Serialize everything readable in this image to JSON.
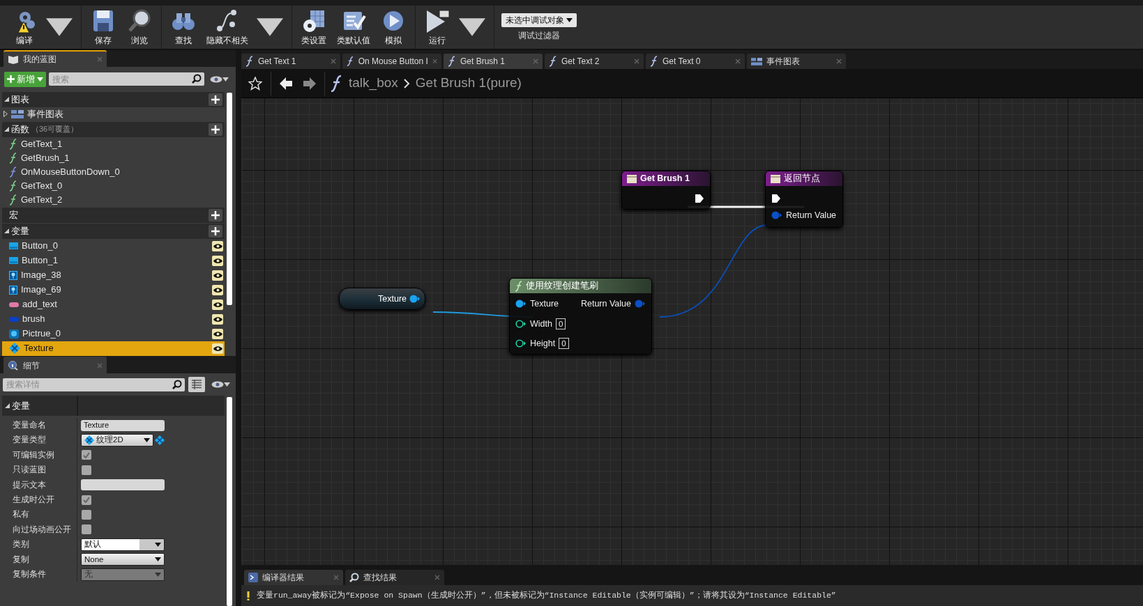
{
  "toolbar": {
    "groups": [
      [
        {
          "label": "编译",
          "kind": "compile",
          "dropdown": true
        }
      ],
      [
        {
          "label": "保存",
          "kind": "save",
          "dropdown": false
        },
        {
          "label": "浏览",
          "kind": "browse",
          "dropdown": false
        }
      ],
      [
        {
          "label": "查找",
          "kind": "find",
          "dropdown": false
        },
        {
          "label": "隐藏不相关",
          "kind": "hide",
          "dropdown": true
        }
      ],
      [
        {
          "label": "类设置",
          "kind": "settings",
          "dropdown": false
        },
        {
          "label": "类默认值",
          "kind": "defaults",
          "dropdown": false
        },
        {
          "label": "模拟",
          "kind": "simulate",
          "dropdown": false
        }
      ],
      [
        {
          "label": "运行",
          "kind": "run",
          "dropdown": true
        }
      ]
    ],
    "debug_filter": {
      "value": "未选中调试对象",
      "label": "调试过滤器"
    }
  },
  "my_blueprint": {
    "tab": "我的蓝图",
    "new_button": "新增",
    "search": {
      "placeholder": "搜索"
    },
    "sections": [
      {
        "title": "图表",
        "expanded": true,
        "items": [
          {
            "label": "事件图表",
            "kind": "graph",
            "expanded": false
          }
        ]
      },
      {
        "title": "函数",
        "note": "（36可覆盖）",
        "expanded": true,
        "items": [
          {
            "label": "GetText_1",
            "kind": "function"
          },
          {
            "label": "GetBrush_1",
            "kind": "function"
          },
          {
            "label": "OnMouseButtonDown_0",
            "kind": "override"
          },
          {
            "label": "GetText_0",
            "kind": "function"
          },
          {
            "label": "GetText_2",
            "kind": "function"
          }
        ]
      },
      {
        "title": "宏"
      },
      {
        "title": "变量",
        "expanded": true,
        "items": [
          {
            "label": "Button_0",
            "kind": "button",
            "public": true,
            "selected": false
          },
          {
            "label": "Button_1",
            "kind": "button",
            "public": true,
            "selected": false
          },
          {
            "label": "Image_38",
            "kind": "image",
            "public": true,
            "selected": false
          },
          {
            "label": "Image_69",
            "kind": "image",
            "public": true,
            "selected": false
          },
          {
            "label": "add_text",
            "kind": "text",
            "public": true,
            "selected": false
          },
          {
            "label": "brush",
            "kind": "brush",
            "public": true,
            "selected": false
          },
          {
            "label": "Pictrue_0",
            "kind": "widget",
            "public": true,
            "selected": false
          },
          {
            "label": "Texture",
            "kind": "texture",
            "public": true,
            "selected": true
          }
        ]
      }
    ]
  },
  "details": {
    "tab": "细节",
    "search": {
      "placeholder": "搜索详情"
    },
    "section": "变量",
    "properties": [
      {
        "label": "变量命名",
        "kind": "text",
        "value": "Texture"
      },
      {
        "label": "变量类型",
        "kind": "type",
        "value": "纹理2D"
      },
      {
        "label": "可编辑实例",
        "kind": "checkbox",
        "checked": true
      },
      {
        "label": "只读蓝图",
        "kind": "checkbox",
        "checked": false
      },
      {
        "label": "提示文本",
        "kind": "text"
      },
      {
        "label": "生成时公开",
        "kind": "checkbox",
        "checked": true
      },
      {
        "label": "私有",
        "kind": "checkbox",
        "checked": false
      },
      {
        "label": "向过场动画公开",
        "kind": "checkbox",
        "checked": false
      },
      {
        "label": "类别",
        "kind": "combo",
        "value": "默认",
        "disabled": false
      },
      {
        "label": "复制",
        "kind": "dropdown",
        "value": "None",
        "disabled": false
      },
      {
        "label": "复制条件",
        "kind": "dropdown",
        "value": "无",
        "disabled": true
      }
    ]
  },
  "graph": {
    "tabs": [
      {
        "label": "Get Text 1",
        "kind": "function",
        "selected": false
      },
      {
        "label": "On Mouse Button I",
        "kind": "function",
        "selected": false
      },
      {
        "label": "Get Brush 1",
        "kind": "function",
        "selected": true
      },
      {
        "label": "Get Text 2",
        "kind": "function",
        "selected": false
      },
      {
        "label": "Get Text 0",
        "kind": "function",
        "selected": false
      },
      {
        "label": "事件图表",
        "kind": "graph",
        "selected": false
      }
    ],
    "breadcrumb": [
      "talk_box",
      "Get Brush 1(pure)"
    ],
    "nodes": [
      {
        "kind": "entry",
        "title": "Get Brush 1"
      },
      {
        "kind": "return",
        "title": "返回节点",
        "pins": [
          {
            "label": "Return Value"
          }
        ]
      },
      {
        "kind": "variable",
        "title": "Texture"
      },
      {
        "kind": "function",
        "title": "使用纹理创建笔刷",
        "inputs": [
          {
            "label": "Texture",
            "kind": "object"
          },
          {
            "label": "Width",
            "kind": "int",
            "value": "0"
          },
          {
            "label": "Height",
            "kind": "int",
            "value": "0"
          }
        ],
        "outputs": [
          {
            "label": "Return Value"
          }
        ]
      }
    ]
  },
  "bottom": {
    "tabs": [
      {
        "label": "编译器结果",
        "kind": "compiler",
        "selected": true
      },
      {
        "label": "查找结果",
        "kind": "find",
        "selected": false
      }
    ],
    "messages": [
      {
        "kind": "warning",
        "text": "变量run_away被标记为“Expose on Spawn（生成时公开）”，但未被标记为“Instance Editable（实例可编辑）”；请将其设为“Instance Editable”"
      }
    ]
  }
}
